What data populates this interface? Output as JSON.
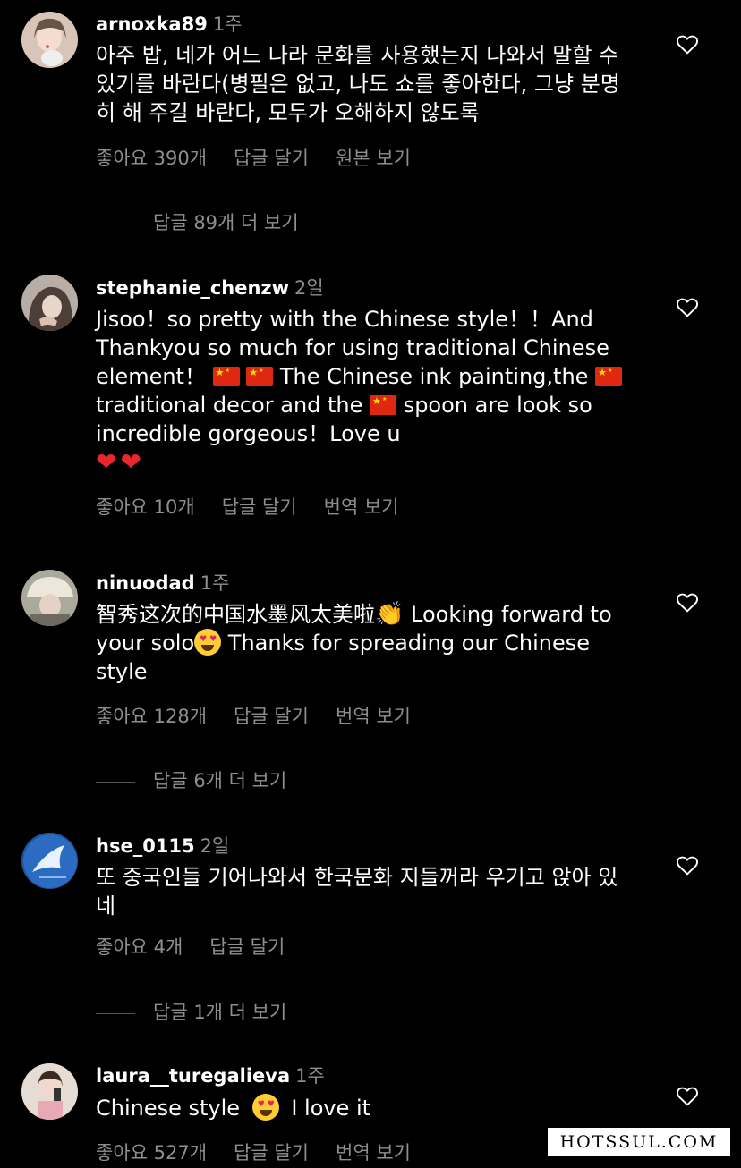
{
  "comments": [
    {
      "username": "arnoxka89",
      "time": "1주",
      "text": "아주 밥, 네가 어느 나라 문화를 사용했는지 나와서 말할 수 있기를 바란다(병필은 없고, 나도 쇼를 좋아한다, 그냥 분명히 해 주길 바란다, 모두가 오해하지 않도록",
      "likes": "좋아요 390개",
      "reply": "답글 달기",
      "extra": "원본 보기",
      "more_replies": "답글 89개 더 보기"
    },
    {
      "username": "stephanie_chenzw",
      "time": "2일",
      "text_parts": [
        "Jisoo！so pretty with the Chinese style！！And Thankyou so much for using traditional Chinese element！",
        "The Chinese ink painting,the",
        "traditional decor and the",
        "spoon are look so incredible gorgeous！Love u"
      ],
      "likes": "좋아요 10개",
      "reply": "답글 달기",
      "extra": "번역 보기"
    },
    {
      "username": "ninuodad",
      "time": "1주",
      "text_parts": [
        "智秀这次的中国水墨风太美啦",
        "Looking forward to your solo",
        "Thanks for spreading our Chinese style"
      ],
      "likes": "좋아요 128개",
      "reply": "답글 달기",
      "extra": "번역 보기",
      "more_replies": "답글 6개 더 보기"
    },
    {
      "username": "hse_0115",
      "time": "2일",
      "text": "또 중국인들 기어나와서 한국문화 지들꺼라 우기고 앉아 있네",
      "likes": "좋아요 4개",
      "reply": "답글 달기",
      "more_replies": "답글 1개 더 보기"
    },
    {
      "username": "laura__turegalieva",
      "time": "1주",
      "text_parts": [
        "Chinese style",
        "I love it"
      ],
      "likes": "좋아요 527개",
      "reply": "답글 달기",
      "extra": "번역 보기"
    }
  ],
  "icons": {
    "heart": "heart-outline-icon",
    "flag": "china-flag-emoji",
    "red_heart": "red-heart-emoji",
    "heart_eyes": "heart-eyes-emoji",
    "clap": "clapping-hands-emoji"
  },
  "watermark": "HOTSSUL.COM"
}
